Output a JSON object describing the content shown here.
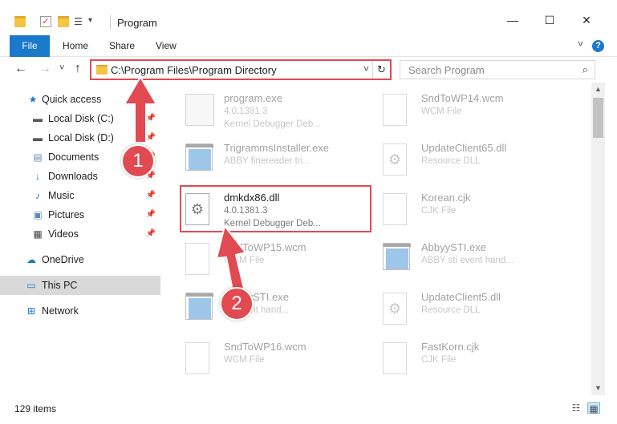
{
  "window": {
    "title": "Program",
    "minimize": "—",
    "maximize": "☐",
    "close": "✕"
  },
  "ribbon": {
    "tabs": [
      "File",
      "Home",
      "Share",
      "View"
    ],
    "help": "?"
  },
  "address": {
    "back": "←",
    "forward": "→",
    "recent": "˅",
    "up": "↑",
    "path": "C:\\Program Files\\Program Directory",
    "dropdown": "˅",
    "refresh": "↻"
  },
  "search": {
    "placeholder": "Search Program",
    "icon": "search-icon"
  },
  "sidebar": {
    "items": [
      {
        "label": "Quick access",
        "icon": "star-icon",
        "pinned": false
      },
      {
        "label": "Local Disk (C:)",
        "icon": "drive-icon",
        "pinned": true
      },
      {
        "label": "Local Disk (D:)",
        "icon": "drive-icon",
        "pinned": true
      },
      {
        "label": "Documents",
        "icon": "documents-icon",
        "pinned": true
      },
      {
        "label": "Downloads",
        "icon": "download-icon",
        "pinned": true
      },
      {
        "label": "Music",
        "icon": "music-icon",
        "pinned": true
      },
      {
        "label": "Pictures",
        "icon": "pictures-icon",
        "pinned": true
      },
      {
        "label": "Videos",
        "icon": "video-icon",
        "pinned": true
      },
      {
        "label": "OneDrive",
        "icon": "cloud-icon",
        "pinned": false
      },
      {
        "label": "This PC",
        "icon": "computer-icon",
        "pinned": false,
        "selected": true
      },
      {
        "label": "Network",
        "icon": "network-icon",
        "pinned": false
      }
    ]
  },
  "files": [
    {
      "name": "program.exe",
      "line1": "4.0.1381.3",
      "line2": "Kernel Debugger Deb...",
      "icon": "exe-icon"
    },
    {
      "name": "SndToWP14.wcm",
      "line1": "WCM File",
      "line2": "",
      "icon": "document-icon"
    },
    {
      "name": "TrigrammsInstaller.exe",
      "line1": "ABBY finereader tri...",
      "line2": "",
      "icon": "app-window-icon"
    },
    {
      "name": "UpdateClient65.dll",
      "line1": "Resource DLL",
      "line2": "",
      "icon": "gear-document-icon"
    },
    {
      "name": "dmkdx86.dll",
      "line1": "4.0.1381.3",
      "line2": "Kernel Debugger Deb...",
      "icon": "gear-document-icon"
    },
    {
      "name": "Korean.cjk",
      "line1": "CJK File",
      "line2": "",
      "icon": "document-icon"
    },
    {
      "name": "SndToWP15.wcm",
      "line1": "WCM File",
      "line2": "",
      "icon": "document-icon"
    },
    {
      "name": "AbbyySTI.exe",
      "line1": "ABBY sti event hand...",
      "line2": "",
      "icon": "app-window-icon"
    },
    {
      "name": "AbbyySTI.exe",
      "line1": "sti event hand...",
      "line2": "",
      "icon": "app-window-icon"
    },
    {
      "name": "UpdateClient5.dll",
      "line1": "Resource DLL",
      "line2": "",
      "icon": "gear-document-icon"
    },
    {
      "name": "SndToWP16.wcm",
      "line1": "WCM File",
      "line2": "",
      "icon": "document-icon"
    },
    {
      "name": "FastKorn.cjk",
      "line1": "CJK File",
      "line2": "",
      "icon": "document-icon"
    }
  ],
  "annotations": [
    "1",
    "2"
  ],
  "status": {
    "count": "129 items"
  },
  "colors": {
    "accent": "#1979ca",
    "annotation": "#e24a52",
    "selected": "#d9d9d9"
  }
}
